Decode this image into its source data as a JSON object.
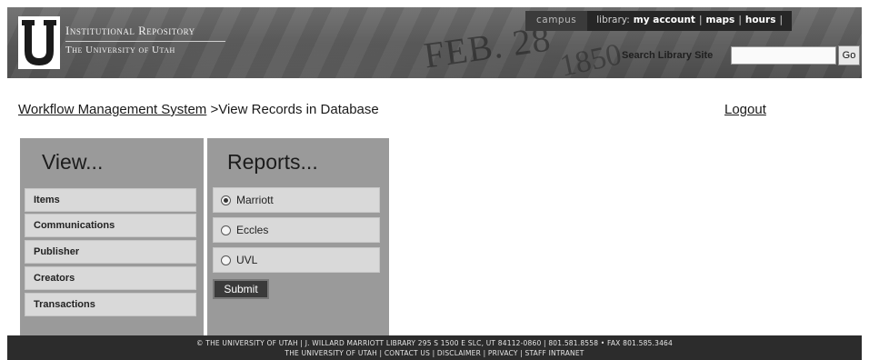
{
  "header": {
    "logo_line1": "Institutional Repository",
    "logo_line2": "The University of Utah",
    "seal_text": "FEB. 28",
    "seal_year": "1850",
    "campus_label": "campus",
    "library_label": "library:",
    "links": [
      "my account",
      "maps",
      "hours"
    ],
    "search_label": "Search Library Site",
    "search_value": "",
    "go_label": "Go"
  },
  "breadcrumb": {
    "parent": "Workflow Management System",
    "current": " >View Records in Database"
  },
  "logout_label": "Logout",
  "view_panel": {
    "title": "View...",
    "items": [
      "Items",
      "Communications",
      "Publisher",
      "Creators",
      "Transactions"
    ]
  },
  "reports_panel": {
    "title": "Reports...",
    "options": [
      "Marriott",
      "Eccles",
      "UVL"
    ],
    "selected": "Marriott",
    "submit_label": "Submit"
  },
  "footer": {
    "line1": "© THE UNIVERSITY OF UTAH | J. WILLARD MARRIOTT LIBRARY 295 S 1500 E SLC, UT 84112-0860 | 801.581.8558 • FAX 801.585.3464",
    "line2": "THE UNIVERSITY OF UTAH | CONTACT US | DISCLAIMER | PRIVACY | STAFF INTRANET"
  },
  "colors": {
    "header_bg": "#5e5e5e",
    "panel_bg": "#9a9a9a",
    "item_bg": "#d9d9d9",
    "footer_bg": "#2c2c2c"
  }
}
